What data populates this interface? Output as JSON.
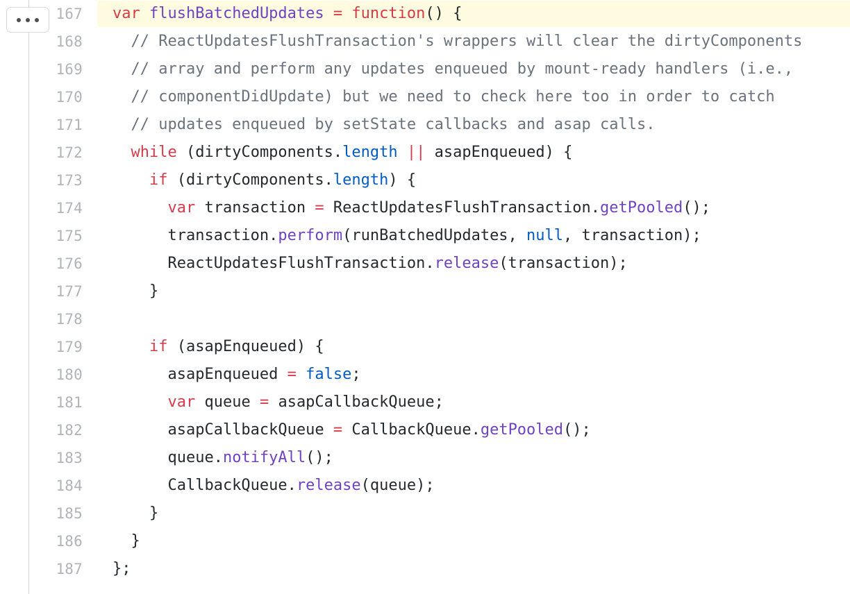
{
  "viewer": {
    "name": "code-diff-viewer",
    "background_color": "#ffffff",
    "highlight_color": "#fffbe0",
    "divider_color": "#d8dade",
    "line_number_color": "#b0b3b8"
  },
  "expand_button": {
    "label": "",
    "icon": "ellipsis-horizontal-icon",
    "dots": [
      "dot",
      "dot",
      "dot"
    ]
  },
  "syntax_colors": {
    "keyword": "#d73a49",
    "function_name": "#6f42c1",
    "method": "#6f42c1",
    "property": "#005cc5",
    "constant": "#005cc5",
    "operator": "#d73a49",
    "comment": "#6a737d",
    "plain": "#24292e"
  },
  "lines": [
    {
      "number": "167",
      "highlighted": true,
      "tokens": [
        {
          "t": "var",
          "c": "tok-kw"
        },
        {
          "t": " ",
          "c": "tok-plain"
        },
        {
          "t": "flushBatchedUpdates",
          "c": "tok-fn"
        },
        {
          "t": " ",
          "c": "tok-plain"
        },
        {
          "t": "=",
          "c": "tok-op"
        },
        {
          "t": " ",
          "c": "tok-plain"
        },
        {
          "t": "function",
          "c": "tok-kw"
        },
        {
          "t": "() {",
          "c": "tok-punc"
        }
      ]
    },
    {
      "number": "168",
      "highlighted": false,
      "tokens": [
        {
          "t": "  // ReactUpdatesFlushTransaction's wrappers will clear the dirtyComponents",
          "c": "tok-comment"
        }
      ]
    },
    {
      "number": "169",
      "highlighted": false,
      "tokens": [
        {
          "t": "  // array and perform any updates enqueued by mount-ready handlers (i.e.,",
          "c": "tok-comment"
        }
      ]
    },
    {
      "number": "170",
      "highlighted": false,
      "tokens": [
        {
          "t": "  // componentDidUpdate) but we need to check here too in order to catch",
          "c": "tok-comment"
        }
      ]
    },
    {
      "number": "171",
      "highlighted": false,
      "tokens": [
        {
          "t": "  // updates enqueued by setState callbacks and asap calls.",
          "c": "tok-comment"
        }
      ]
    },
    {
      "number": "172",
      "highlighted": false,
      "tokens": [
        {
          "t": "  ",
          "c": "tok-plain"
        },
        {
          "t": "while",
          "c": "tok-kw"
        },
        {
          "t": " (dirtyComponents.",
          "c": "tok-punc"
        },
        {
          "t": "length",
          "c": "tok-prop"
        },
        {
          "t": " ",
          "c": "tok-plain"
        },
        {
          "t": "||",
          "c": "tok-op"
        },
        {
          "t": " asapEnqueued) {",
          "c": "tok-punc"
        }
      ]
    },
    {
      "number": "173",
      "highlighted": false,
      "tokens": [
        {
          "t": "    ",
          "c": "tok-plain"
        },
        {
          "t": "if",
          "c": "tok-kw"
        },
        {
          "t": " (dirtyComponents.",
          "c": "tok-punc"
        },
        {
          "t": "length",
          "c": "tok-prop"
        },
        {
          "t": ") {",
          "c": "tok-punc"
        }
      ]
    },
    {
      "number": "174",
      "highlighted": false,
      "tokens": [
        {
          "t": "      ",
          "c": "tok-plain"
        },
        {
          "t": "var",
          "c": "tok-kw"
        },
        {
          "t": " transaction ",
          "c": "tok-plain"
        },
        {
          "t": "=",
          "c": "tok-op"
        },
        {
          "t": " ReactUpdatesFlushTransaction.",
          "c": "tok-punc"
        },
        {
          "t": "getPooled",
          "c": "tok-method"
        },
        {
          "t": "();",
          "c": "tok-punc"
        }
      ]
    },
    {
      "number": "175",
      "highlighted": false,
      "tokens": [
        {
          "t": "      transaction.",
          "c": "tok-punc"
        },
        {
          "t": "perform",
          "c": "tok-method"
        },
        {
          "t": "(runBatchedUpdates, ",
          "c": "tok-punc"
        },
        {
          "t": "null",
          "c": "tok-const"
        },
        {
          "t": ", transaction);",
          "c": "tok-punc"
        }
      ]
    },
    {
      "number": "176",
      "highlighted": false,
      "tokens": [
        {
          "t": "      ReactUpdatesFlushTransaction.",
          "c": "tok-punc"
        },
        {
          "t": "release",
          "c": "tok-method"
        },
        {
          "t": "(transaction);",
          "c": "tok-punc"
        }
      ]
    },
    {
      "number": "177",
      "highlighted": false,
      "tokens": [
        {
          "t": "    }",
          "c": "tok-punc"
        }
      ]
    },
    {
      "number": "178",
      "highlighted": false,
      "tokens": [
        {
          "t": "",
          "c": "tok-plain"
        }
      ]
    },
    {
      "number": "179",
      "highlighted": false,
      "tokens": [
        {
          "t": "    ",
          "c": "tok-plain"
        },
        {
          "t": "if",
          "c": "tok-kw"
        },
        {
          "t": " (asapEnqueued) {",
          "c": "tok-punc"
        }
      ]
    },
    {
      "number": "180",
      "highlighted": false,
      "tokens": [
        {
          "t": "      asapEnqueued ",
          "c": "tok-plain"
        },
        {
          "t": "=",
          "c": "tok-op"
        },
        {
          "t": " ",
          "c": "tok-plain"
        },
        {
          "t": "false",
          "c": "tok-const"
        },
        {
          "t": ";",
          "c": "tok-punc"
        }
      ]
    },
    {
      "number": "181",
      "highlighted": false,
      "tokens": [
        {
          "t": "      ",
          "c": "tok-plain"
        },
        {
          "t": "var",
          "c": "tok-kw"
        },
        {
          "t": " queue ",
          "c": "tok-plain"
        },
        {
          "t": "=",
          "c": "tok-op"
        },
        {
          "t": " asapCallbackQueue;",
          "c": "tok-punc"
        }
      ]
    },
    {
      "number": "182",
      "highlighted": false,
      "tokens": [
        {
          "t": "      asapCallbackQueue ",
          "c": "tok-plain"
        },
        {
          "t": "=",
          "c": "tok-op"
        },
        {
          "t": " CallbackQueue.",
          "c": "tok-punc"
        },
        {
          "t": "getPooled",
          "c": "tok-method"
        },
        {
          "t": "();",
          "c": "tok-punc"
        }
      ]
    },
    {
      "number": "183",
      "highlighted": false,
      "tokens": [
        {
          "t": "      queue.",
          "c": "tok-punc"
        },
        {
          "t": "notifyAll",
          "c": "tok-method"
        },
        {
          "t": "();",
          "c": "tok-punc"
        }
      ]
    },
    {
      "number": "184",
      "highlighted": false,
      "tokens": [
        {
          "t": "      CallbackQueue.",
          "c": "tok-punc"
        },
        {
          "t": "release",
          "c": "tok-method"
        },
        {
          "t": "(queue);",
          "c": "tok-punc"
        }
      ]
    },
    {
      "number": "185",
      "highlighted": false,
      "tokens": [
        {
          "t": "    }",
          "c": "tok-punc"
        }
      ]
    },
    {
      "number": "186",
      "highlighted": false,
      "tokens": [
        {
          "t": "  }",
          "c": "tok-punc"
        }
      ]
    },
    {
      "number": "187",
      "highlighted": false,
      "tokens": [
        {
          "t": "};",
          "c": "tok-punc"
        }
      ]
    }
  ]
}
